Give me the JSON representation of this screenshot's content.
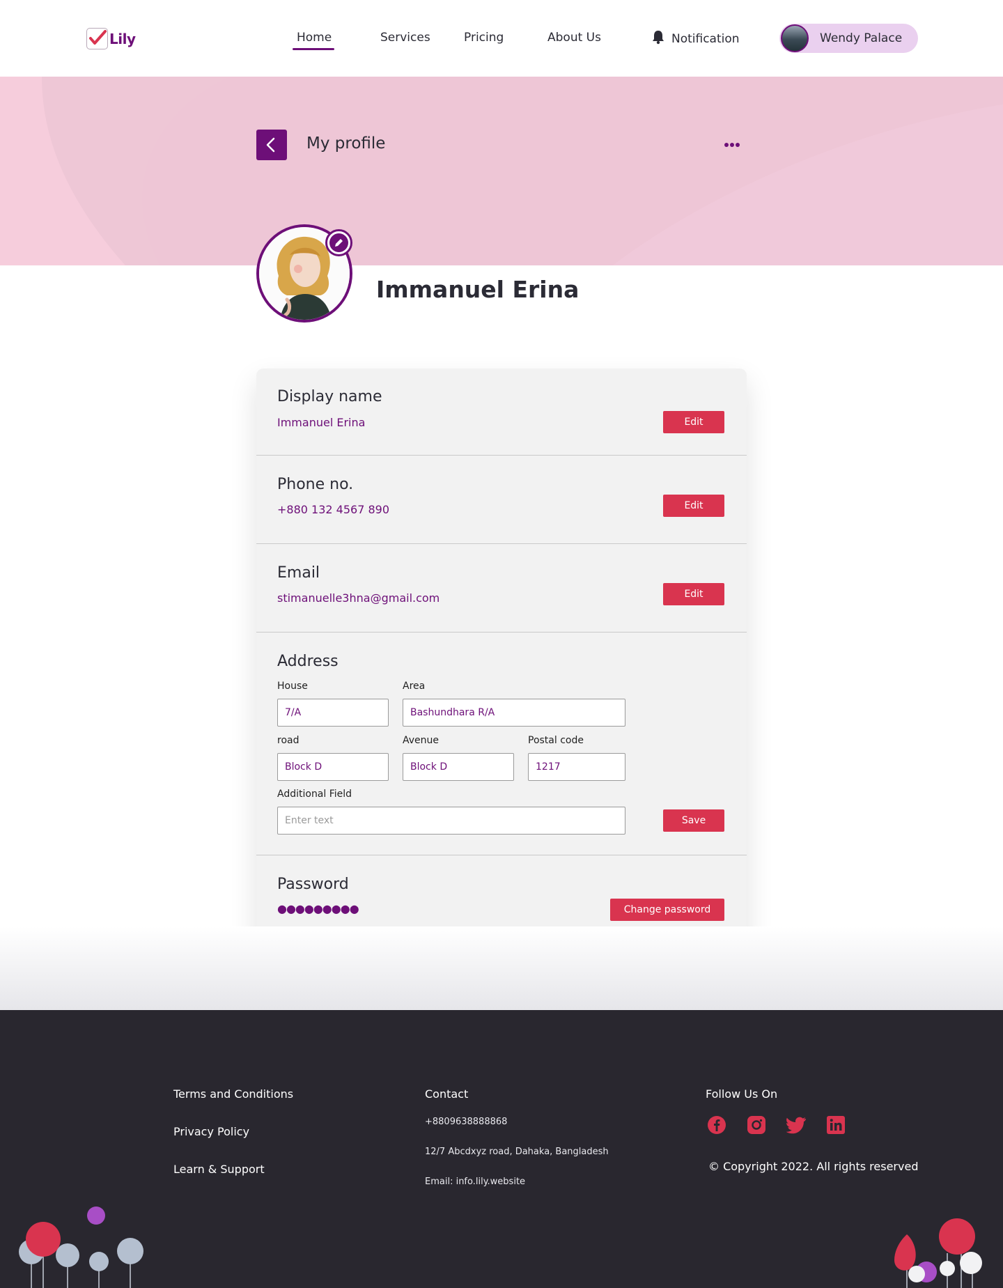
{
  "brand": {
    "name": "Lily",
    "color": "#6d0f78",
    "accent": "#d9344f"
  },
  "nav": {
    "items": [
      {
        "label": "Home",
        "active": true
      },
      {
        "label": "Services"
      },
      {
        "label": "Pricing"
      },
      {
        "label": "About Us"
      }
    ],
    "notification_label": "Notification",
    "user_name": "Wendy Palace"
  },
  "page": {
    "title": "My profile"
  },
  "profile": {
    "name": "Immanuel Erina"
  },
  "sections": {
    "display_name": {
      "title": "Display name",
      "value": "Immanuel Erina",
      "button": "Edit"
    },
    "phone": {
      "title": "Phone no.",
      "value": "+880 132 4567 890",
      "button": "Edit"
    },
    "email": {
      "title": "Email",
      "value": "stimanuelle3hna@gmail.com",
      "button": "Edit"
    },
    "address": {
      "title": "Address",
      "house": {
        "label": "House",
        "value": "7/A"
      },
      "area": {
        "label": "Area",
        "value": "Bashundhara R/A"
      },
      "road": {
        "label": "road",
        "value": "Block D"
      },
      "avenue": {
        "label": "Avenue",
        "value": "Block D"
      },
      "postal": {
        "label": "Postal code",
        "value": "1217"
      },
      "additional": {
        "label": "Additional Field",
        "placeholder": "Enter text"
      },
      "button": "Save"
    },
    "password": {
      "title": "Password",
      "value": "●●●●●●●●●",
      "button": "Change password"
    }
  },
  "footer": {
    "links": [
      "Terms and Conditions",
      "Privacy Policy",
      "Learn & Support"
    ],
    "contact": {
      "title": "Contact",
      "phone": "+8809638888868",
      "address": "12/7 Abcdxyz road, Dahaka, Bangladesh",
      "email": "Email: info.lily.website"
    },
    "follow": {
      "title": "Follow Us On",
      "icons": [
        "facebook-icon",
        "instagram-icon",
        "twitter-icon",
        "linkedin-icon"
      ]
    },
    "copyright": "© Copyright 2022. All rights reserved"
  }
}
